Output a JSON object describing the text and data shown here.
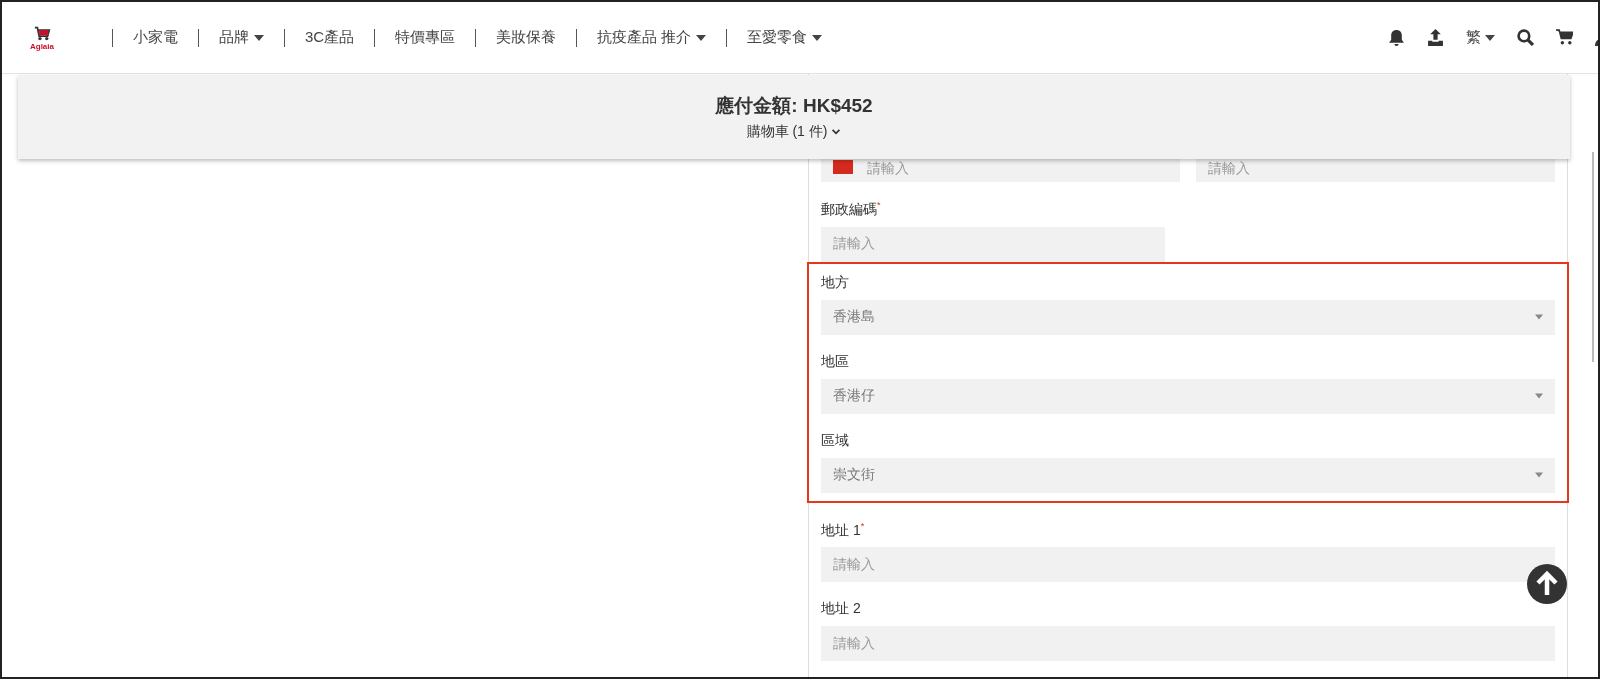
{
  "logo": {
    "text": "Aglaia"
  },
  "nav": [
    {
      "label": "小家電",
      "dropdown": false
    },
    {
      "label": "品牌",
      "dropdown": true
    },
    {
      "label": "3C產品",
      "dropdown": false
    },
    {
      "label": "特價專區",
      "dropdown": false
    },
    {
      "label": "美妝保養",
      "dropdown": false
    },
    {
      "label": "抗疫產品 推介",
      "dropdown": true
    },
    {
      "label": "至愛零食",
      "dropdown": true
    }
  ],
  "language": "繁",
  "summary": {
    "total_label": "應付金額:",
    "total": "HK$452",
    "cart": "購物車",
    "cart_count": "(1 件)"
  },
  "phone_row": [
    {
      "placeholder": "請輸入",
      "flag": true
    },
    {
      "placeholder": "請輸入",
      "flag": false
    }
  ],
  "sections": [
    {
      "highlighted": false,
      "fields": [
        {
          "kind": "input",
          "label": "郵政編碼$^{*}$",
          "placeholder": "請輸入",
          "half": true
        }
      ]
    },
    {
      "highlighted": true,
      "fields": [
        {
          "kind": "select",
          "label": "地方",
          "value": "香港島",
          "half": false
        },
        {
          "kind": "select",
          "label": "地區",
          "value": "香港仔",
          "half": false
        },
        {
          "kind": "select",
          "label": "區域",
          "value": "崇文街",
          "half": false
        }
      ]
    },
    {
      "highlighted": false,
      "fields": [
        {
          "kind": "input",
          "label": "地址 1$^{*}$",
          "placeholder": "請輸入",
          "half": false
        },
        {
          "kind": "input",
          "label": "地址 2",
          "placeholder": "請輸入",
          "half": false
        }
      ]
    }
  ]
}
